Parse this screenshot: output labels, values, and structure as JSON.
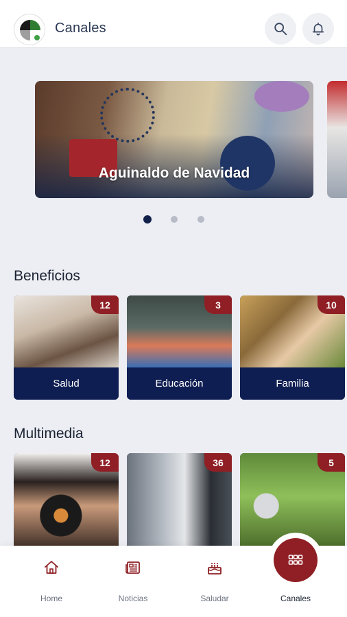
{
  "header": {
    "title": "Canales",
    "logo_icon": "canal-logo-icon",
    "search_icon": "search-icon",
    "notification_icon": "bell-icon"
  },
  "carousel": {
    "slides": [
      {
        "title": "Aguinaldo de Navidad"
      }
    ],
    "active_index": 0,
    "total": 3
  },
  "sections": {
    "beneficios": {
      "title": "Beneficios",
      "cards": [
        {
          "label": "Salud",
          "count": "12"
        },
        {
          "label": "Educación",
          "count": "3"
        },
        {
          "label": "Familia",
          "count": "10"
        }
      ]
    },
    "multimedia": {
      "title": "Multimedia",
      "cards": [
        {
          "count": "12"
        },
        {
          "count": "36"
        },
        {
          "count": "5"
        }
      ]
    }
  },
  "bottom_nav": {
    "items": [
      {
        "label": "Home",
        "icon": "home-icon"
      },
      {
        "label": "Noticias",
        "icon": "newspaper-icon"
      },
      {
        "label": "Saludar",
        "icon": "cake-icon"
      },
      {
        "label": "Canales",
        "icon": "grid-icon"
      }
    ],
    "active": "Canales"
  },
  "colors": {
    "primary_navy": "#0f1e52",
    "accent_red": "#8f1f24",
    "background": "#eceef3"
  }
}
